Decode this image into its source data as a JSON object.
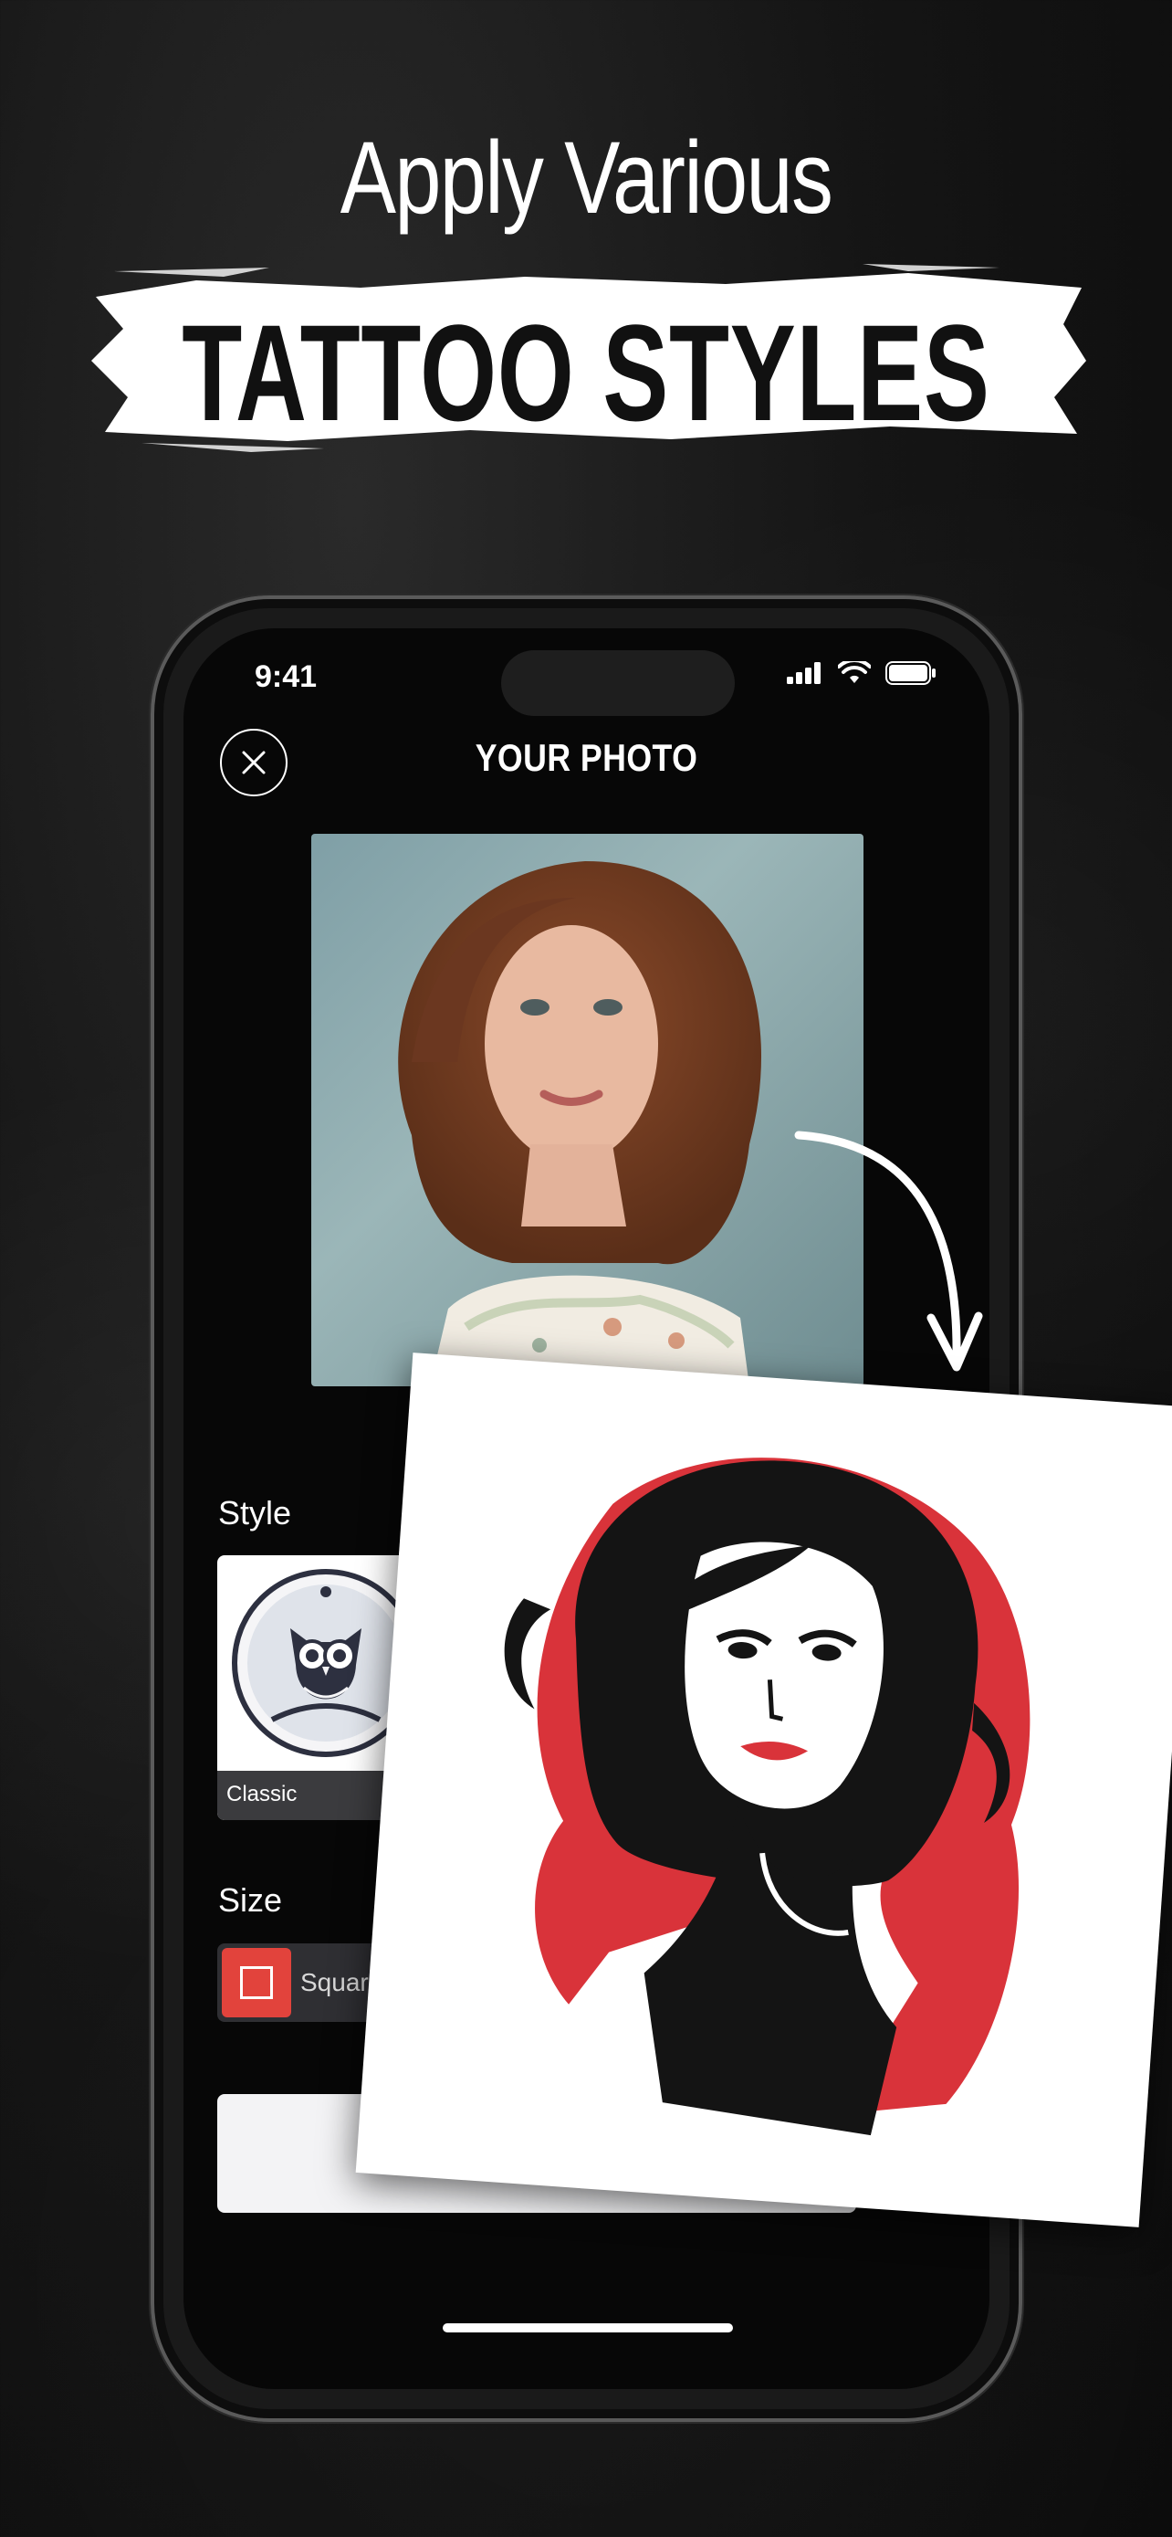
{
  "headline": {
    "line1": "Apply Various",
    "line2": "TATTOO STYLES"
  },
  "status_bar": {
    "time": "9:41"
  },
  "screen": {
    "title": "YOUR PHOTO",
    "style_section_label": "Style",
    "style_option": {
      "label": "Classic"
    },
    "size_section_label": "Size",
    "size_option": {
      "label": "Square"
    }
  },
  "colors": {
    "accent": "#e2433c",
    "background": "#0b0b0b",
    "card": "#ffffff"
  },
  "icons": {
    "close": "close-icon",
    "signal": "signal-icon",
    "wifi": "wifi-icon",
    "battery": "battery-icon",
    "arrow": "curved-arrow-icon",
    "owl": "owl-tattoo-icon"
  }
}
